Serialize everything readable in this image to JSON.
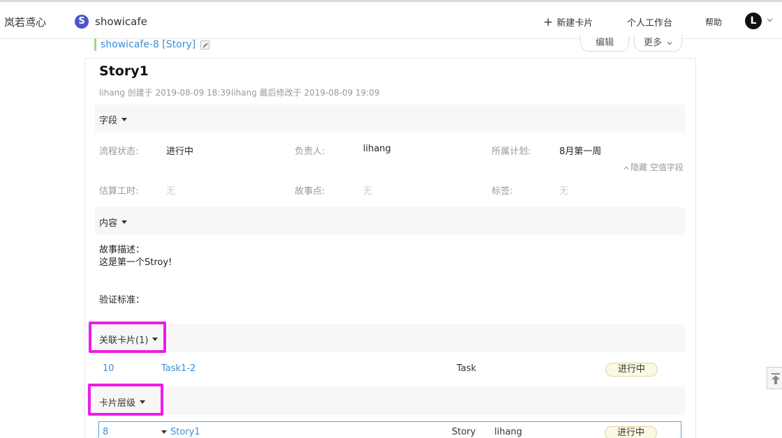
{
  "nav": {
    "brand": "岚若鸢心",
    "project_initial": "S",
    "project_name": "showicafe",
    "new_card": "新建卡片",
    "workbench": "个人工作台",
    "help": "帮助",
    "avatar_initial": "L"
  },
  "breadcrumb": {
    "card_ref": "showicafe-8 [Story]"
  },
  "actions": {
    "edit": "编辑",
    "more": "更多"
  },
  "card": {
    "title": "Story1",
    "created": "lihang 创建于 2019-08-09 18:39",
    "modified": "lihang 最后修改于 2019-08-09 19:09"
  },
  "fields_section": {
    "label": "字段",
    "hide_empty": "隐藏 空值字段",
    "fields": [
      {
        "label": "流程状态:",
        "value": "进行中"
      },
      {
        "label": "负责人:",
        "value": "lihang"
      },
      {
        "label": "所属计划:",
        "value": "8月第一周"
      },
      {
        "label": "估算工时:",
        "value": "无"
      },
      {
        "label": "故事点:",
        "value": "无"
      },
      {
        "label": "标签:",
        "value": "无"
      }
    ]
  },
  "content_section": {
    "label": "内容",
    "story_desc_label": "故事描述：",
    "story_desc_text": "这是第一个Stroy!",
    "acceptance_label": "验证标准："
  },
  "related_section": {
    "label": "关联卡片(1)",
    "rows": [
      {
        "id": "10",
        "title": "Task1-2",
        "type": "Task",
        "status": "进行中"
      }
    ]
  },
  "hierarchy_section": {
    "label": "卡片层级",
    "rows": [
      {
        "id": "8",
        "title": "Story1",
        "type": "Story",
        "owner": "lihang",
        "status": "进行中"
      }
    ]
  },
  "colors": {
    "link": "#3a8ed6",
    "highlight": "#ee1be6",
    "status_bg": "#fbf8e3",
    "project_icon": "#4a57c9"
  }
}
